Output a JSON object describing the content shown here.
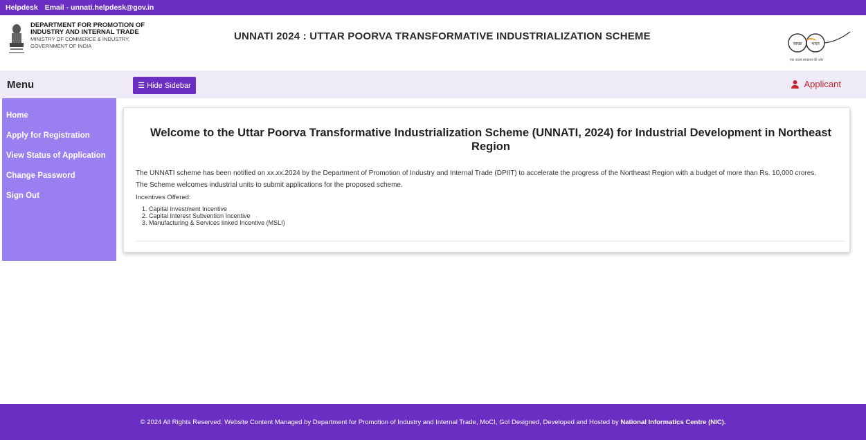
{
  "topbar": {
    "helpdesk": "Helpdesk",
    "email": "Email - unnati.helpdesk@gov.in"
  },
  "header": {
    "dept_line1": "DEPARTMENT FOR PROMOTION OF",
    "dept_line2": "INDUSTRY AND INTERNAL TRADE",
    "dept_line3": "MINISTRY OF COMMERCE & INDUSTRY,",
    "dept_line4": "GOVERNMENT OF INDIA",
    "title": "UNNATI 2024 : UTTAR POORVA TRANSFORMATIVE INDUSTRIALIZATION SCHEME",
    "swachh_left": "स्वच्छ",
    "swachh_right": "भारत",
    "swachh_tagline": "एक कदम स्वच्छता की ओर"
  },
  "menubar": {
    "menu_label": "Menu",
    "hide_sidebar": "Hide Sidebar",
    "applicant": "Applicant"
  },
  "sidebar": {
    "items": [
      {
        "label": "Home"
      },
      {
        "label": "Apply for Registration"
      },
      {
        "label": "View Status of Application"
      },
      {
        "label": "Change Password"
      },
      {
        "label": "Sign Out"
      }
    ]
  },
  "main": {
    "welcome": "Welcome to the Uttar Poorva Transformative Industrialization Scheme (UNNATI, 2024) for Industrial Development in Northeast Region",
    "intro_line1": "The UNNATI scheme has been notified on xx.xx.2024 by the Department of Promotion of Industry and Internal Trade (DPIIT) to accelerate the progress of the Northeast Region with a budget of more than Rs. 10,000 crores.",
    "intro_line2": "The Scheme welcomes industrial units to submit applications for the proposed scheme.",
    "incentives_label": "Incentives Offered:",
    "incentives": [
      "1. Capital Investment Incentive",
      "2. Capital Interest Subvention Incentive",
      "3. Manufacturing & Services linked Incentive (MSLI)"
    ]
  },
  "footer": {
    "text": "© 2024 All Rights Reserved. Website Content Managed by Department for Promotion of Industry and Internal Trade, MoCI, GoI Designed, Developed and Hosted by",
    "nic": "National Informatics Centre (NIC)."
  },
  "colors": {
    "primary": "#6a2fc2",
    "sidebar": "#9a7ff0",
    "menubar": "#efeaf7",
    "applicant": "#c0262d"
  }
}
